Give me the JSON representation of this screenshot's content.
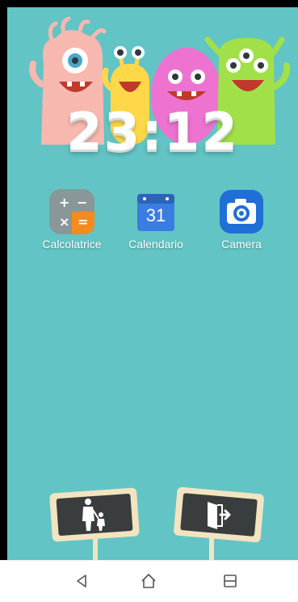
{
  "clock": {
    "time": "23:12"
  },
  "apps": [
    {
      "label": "Calcolatrice",
      "icon": "calculator-icon"
    },
    {
      "label": "Calendario",
      "icon": "calendar-icon",
      "day": "31"
    },
    {
      "label": "Camera",
      "icon": "camera-icon"
    }
  ],
  "signs": [
    {
      "icon": "parent-child-icon"
    },
    {
      "icon": "exit-door-icon"
    }
  ],
  "navbar": {
    "back": "back-icon",
    "home": "home-icon",
    "recents": "recents-icon"
  },
  "colors": {
    "background": "#62c4c4",
    "sign_board": "#3a3d3d",
    "sign_frame": "#f2e4c0"
  }
}
